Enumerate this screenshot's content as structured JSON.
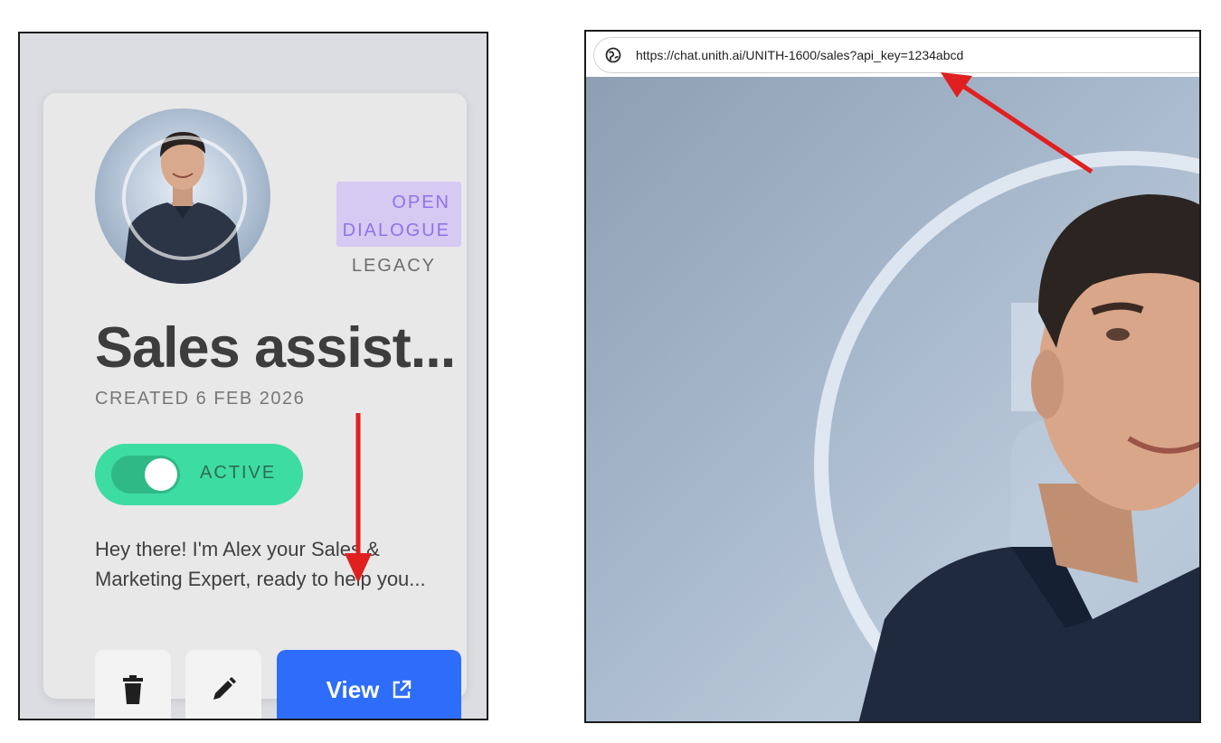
{
  "card": {
    "tag_open": "OPEN DIALOGUE",
    "tag_legacy": "LEGACY",
    "title": "Sales assist...",
    "created": "CREATED 6 FEB 2026",
    "status_label": "ACTIVE",
    "status_active": true,
    "description": "Hey there! I'm Alex your Sales & Marketing Expert, ready to help you...",
    "view_label": "View"
  },
  "browser": {
    "url": "https://chat.unith.ai/UNITH-1600/sales?api_key=1234abcd"
  },
  "colors": {
    "tag_bg": "#d6c9f2",
    "tag_text": "#8f72ea",
    "toggle_green": "#3ddca2",
    "view_button": "#2e6dfa",
    "annotation_arrow": "#e02020"
  }
}
